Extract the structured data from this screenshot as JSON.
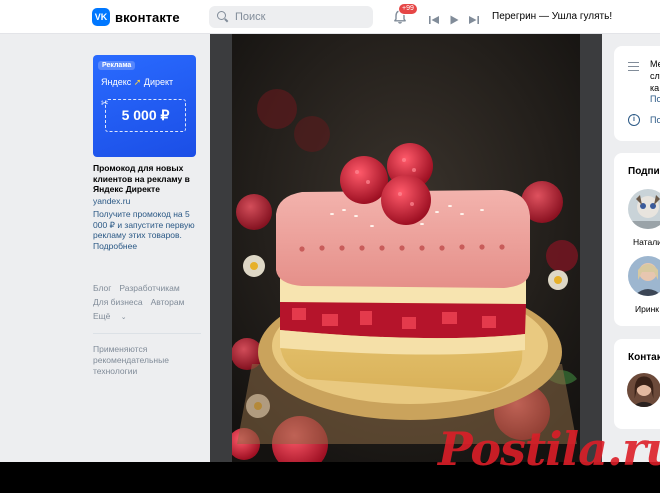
{
  "header": {
    "logo_mark": "VK",
    "logo_text": "вконтакте",
    "search_placeholder": "Поиск",
    "notifications_badge": "+99",
    "now_playing": "Перегрин — Ушла гулять!"
  },
  "sidebar": {
    "ad": {
      "label": "Реклама",
      "brand_left": "Яндекс",
      "brand_right": "Директ",
      "amount": "5 000 ₽",
      "title": "Промокод для новых клиентов на рекламу в Яндекс Директе",
      "domain": "yandex.ru",
      "description": "Получите промокод на 5 000 ₽ и запустите первую рекламу этих товаров. Подробнее"
    },
    "links": [
      "Блог",
      "Разработчикам",
      "Для бизнеса",
      "Авторам",
      "Ещё"
    ],
    "note": "Применяются рекомендательные технологии"
  },
  "right": {
    "card1_text": [
      "Ме",
      "сл",
      "ка"
    ],
    "card1_link": "По",
    "card1_link2": "По",
    "subscriptions_title": "Подпис",
    "subscriptions": [
      {
        "name": "Натали"
      },
      {
        "name": "Иринк"
      }
    ],
    "contacts_title": "Контак"
  },
  "watermark": "Postila.ru",
  "colors": {
    "vk_blue": "#0077ff",
    "link": "#2a5885",
    "badge": "#e64646",
    "background": "#edeef0"
  }
}
